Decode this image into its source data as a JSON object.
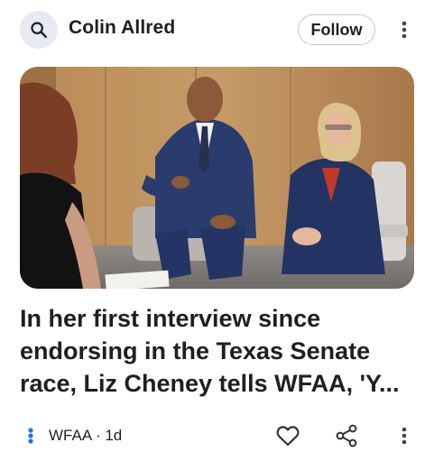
{
  "header": {
    "search_icon": "search-icon",
    "title": "Colin Allred",
    "follow_label": "Follow",
    "more_icon": "more-vert-icon"
  },
  "article": {
    "image_alt": "Interview photo",
    "headline_lines": [
      "In her first interview since",
      "endorsing in the Texas Senate",
      "race, Liz Cheney tells WFAA, 'Y..."
    ],
    "source": "WFAA",
    "age": "1d",
    "source_line": "WFAA · 1d"
  },
  "footer_icons": {
    "like": "heart-icon",
    "share": "share-icon",
    "more": "more-vert-icon"
  },
  "colors": {
    "search_bg": "#e8eaf2",
    "source_logo": "#1a73e8",
    "text": "#1f1f1f"
  }
}
